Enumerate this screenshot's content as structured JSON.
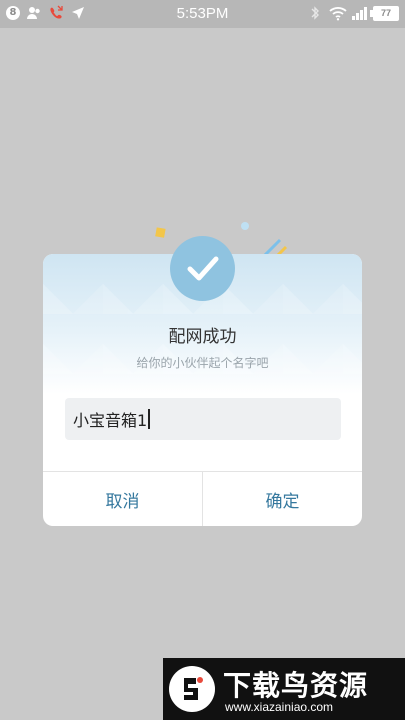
{
  "status_bar": {
    "notification_count": "8",
    "time": "5:53PM",
    "battery": "77"
  },
  "dialog": {
    "title": "配网成功",
    "subtitle": "给你的小伙伴起个名字吧",
    "input_value": "小宝音箱1",
    "cancel_label": "取消",
    "confirm_label": "确定"
  },
  "watermark": {
    "title": "下载鸟资源",
    "url": "www.xiazainiao.com"
  },
  "colors": {
    "overlay": "#c9c9c9",
    "accent_button_text": "#35789e",
    "badge": "#8fc3e0"
  }
}
